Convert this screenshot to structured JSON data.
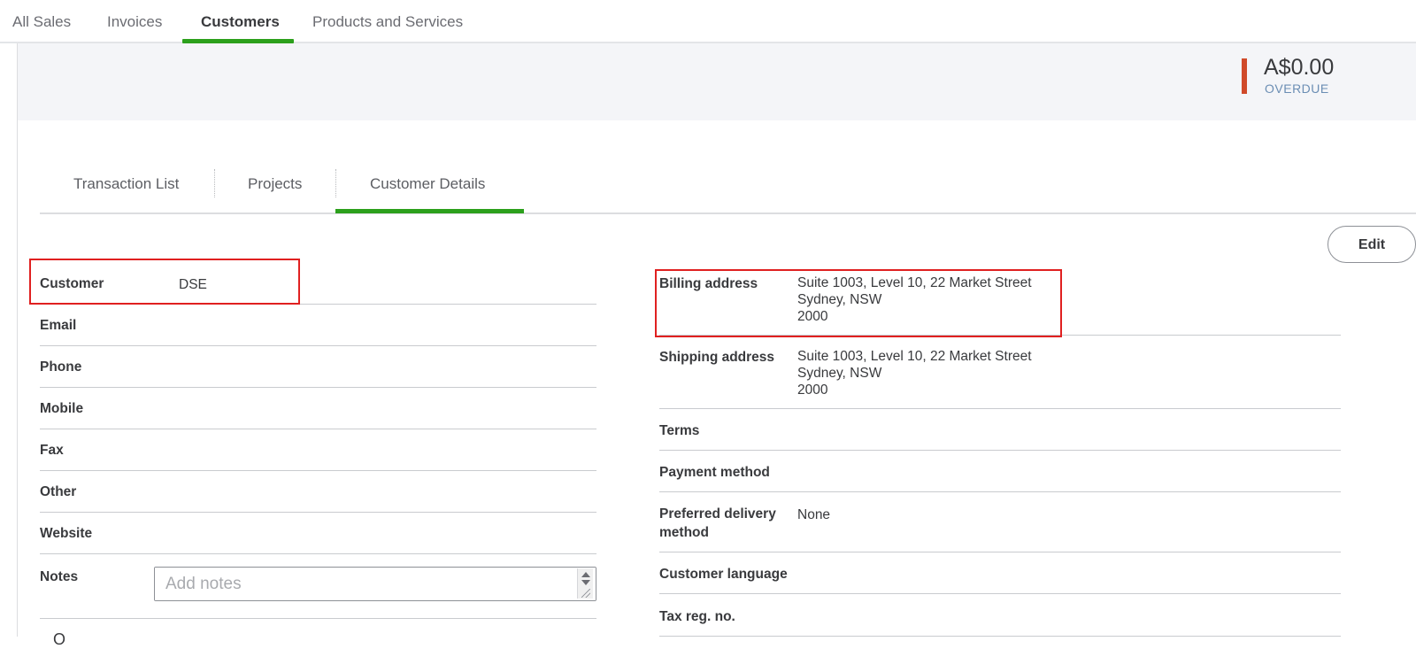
{
  "top_nav": {
    "tabs": [
      {
        "label": "All Sales",
        "active": false
      },
      {
        "label": "Invoices",
        "active": false
      },
      {
        "label": "Customers",
        "active": true
      },
      {
        "label": "Products and Services",
        "active": false
      }
    ]
  },
  "summary": {
    "overdue_amount": "A$0.00",
    "overdue_label": "OVERDUE",
    "overdue_color": "#d04a2a"
  },
  "sub_tabs": [
    {
      "label": "Transaction List",
      "active": false
    },
    {
      "label": "Projects",
      "active": false
    },
    {
      "label": "Customer Details",
      "active": true
    }
  ],
  "edit_label": "Edit",
  "left_details": [
    {
      "label": "Customer",
      "value": "DSE"
    },
    {
      "label": "Email",
      "value": ""
    },
    {
      "label": "Phone",
      "value": ""
    },
    {
      "label": "Mobile",
      "value": ""
    },
    {
      "label": "Fax",
      "value": ""
    },
    {
      "label": "Other",
      "value": ""
    },
    {
      "label": "Website",
      "value": ""
    }
  ],
  "notes": {
    "label": "Notes",
    "placeholder": "Add notes",
    "value": ""
  },
  "right_details": {
    "billing": {
      "label": "Billing address",
      "line1": "Suite 1003, Level 10, 22 Market Street",
      "line2": "Sydney, NSW",
      "line3": "2000"
    },
    "shipping": {
      "label": "Shipping address",
      "line1": "Suite 1003, Level 10, 22 Market Street",
      "line2": "Sydney, NSW",
      "line3": "2000"
    },
    "terms": {
      "label": "Terms",
      "value": ""
    },
    "payment_method": {
      "label": "Payment method",
      "value": ""
    },
    "preferred_delivery": {
      "label_line1": "Preferred delivery",
      "label_line2": "method",
      "value": "None"
    },
    "customer_language": {
      "label": "Customer language",
      "value": ""
    },
    "tax_reg": {
      "label": "Tax reg. no.",
      "value": ""
    }
  },
  "partial_text": "O",
  "colors": {
    "accent_green": "#2ca01c",
    "highlight_red": "#e02020"
  }
}
